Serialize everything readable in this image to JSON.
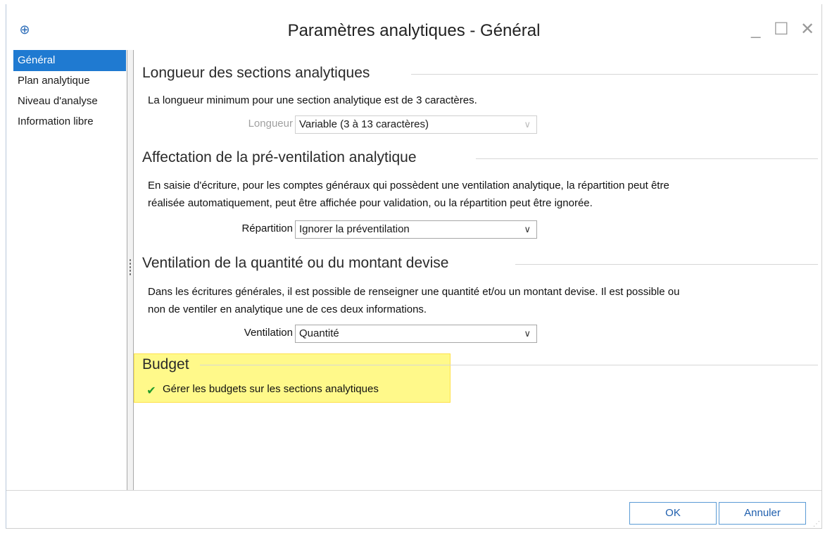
{
  "window": {
    "title": "Paramètres analytiques - Général",
    "controls": {
      "minimize": "_",
      "maximize": "☐",
      "close": "✕"
    },
    "app_icon": "app-logo-icon"
  },
  "sidebar": {
    "items": [
      {
        "label": "Général",
        "active": true
      },
      {
        "label": "Plan analytique",
        "active": false
      },
      {
        "label": "Niveau d'analyse",
        "active": false
      },
      {
        "label": "Information libre",
        "active": false
      }
    ]
  },
  "sections": {
    "longueur": {
      "title": "Longueur des sections analytiques",
      "description": "La longueur minimum pour une section analytique est de 3 caractères.",
      "field_label": "Longueur",
      "field_value": "Variable (3 à 13 caractères)"
    },
    "affectation": {
      "title": "Affectation de la pré-ventilation analytique",
      "description_line1": "En saisie d'écriture, pour les comptes généraux qui possèdent une ventilation analytique, la répartition peut être",
      "description_line2": "réalisée automatiquement, peut être affichée pour validation, ou la répartition peut être ignorée.",
      "field_label": "Répartition",
      "field_value": "Ignorer la préventilation"
    },
    "ventilation": {
      "title": "Ventilation de la quantité ou du montant devise",
      "description_line1": "Dans les écritures générales, il est possible de renseigner une quantité et/ou un montant devise. Il est possible ou",
      "description_line2": "non de ventiler en analytique une de ces deux informations.",
      "field_label": "Ventilation",
      "field_value": "Quantité"
    },
    "budget": {
      "title": "Budget",
      "checkbox_label": "Gérer les budgets sur les sections analytiques",
      "checked": true
    }
  },
  "footer": {
    "ok_label": "OK",
    "cancel_label": "Annuler"
  },
  "colors": {
    "accent": "#1f7ad1",
    "highlight": "#fff98a",
    "check": "#1f9a2a"
  }
}
